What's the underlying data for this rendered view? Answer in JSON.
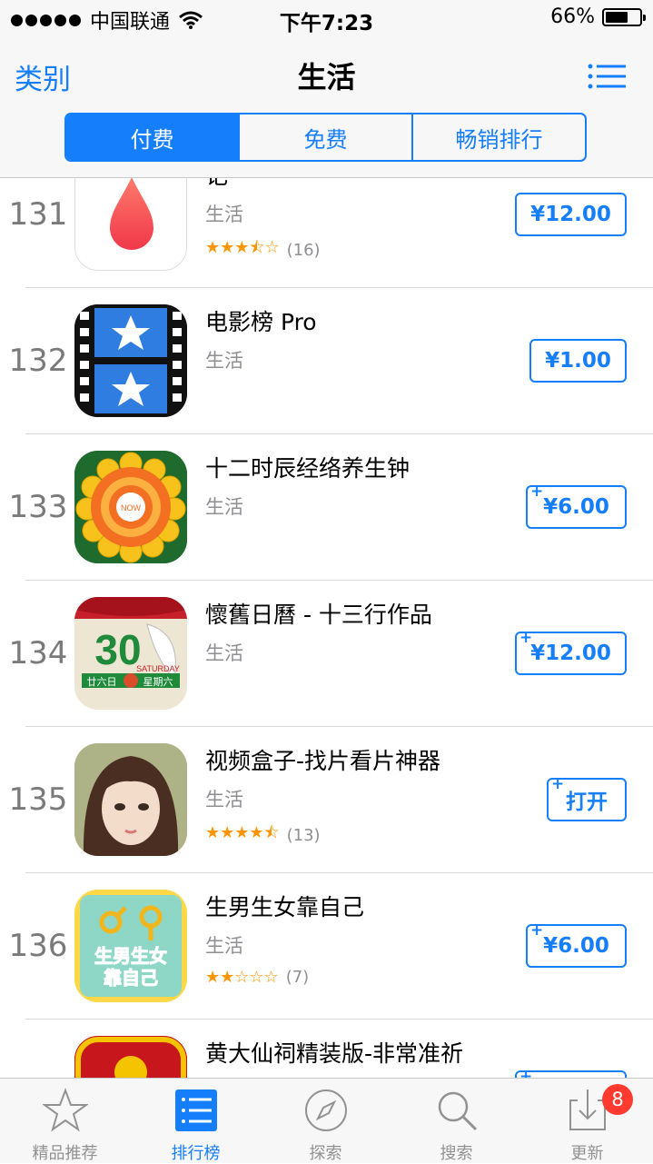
{
  "status_bar": {
    "carrier": "中国联通",
    "time": "下午7:23",
    "battery": "66%",
    "battery_level": 0.66
  },
  "nav": {
    "back_label": "类别",
    "title": "生活",
    "segments": [
      "付费",
      "免费",
      "畅销排行"
    ]
  },
  "apps": [
    {
      "rank": "131",
      "name": "记",
      "category": "生活",
      "stars": "★★★⯪☆",
      "rating_count": "(16)",
      "price": "¥12.00",
      "plus": false
    },
    {
      "rank": "132",
      "name": "电影榜 Pro",
      "category": "生活",
      "price": "¥1.00",
      "plus": false
    },
    {
      "rank": "133",
      "name": "十二时辰经络养生钟",
      "category": "生活",
      "price": "¥6.00",
      "plus": true
    },
    {
      "rank": "134",
      "name": "懷舊日曆 - 十三行作品",
      "category": "生活",
      "price": "¥12.00",
      "plus": true
    },
    {
      "rank": "135",
      "name": "视频盒子-找片看片神器",
      "category": "生活",
      "stars": "★★★★⯪",
      "rating_count": "(13)",
      "price": "打开",
      "plus": true
    },
    {
      "rank": "136",
      "name": "生男生女靠自己",
      "category": "生活",
      "stars": "★★☆☆☆",
      "rating_count": "(7)",
      "price": "¥6.00",
      "plus": true
    },
    {
      "rank": "",
      "name": "黄大仙祠精装版-非常准祈",
      "category": "",
      "price": "",
      "plus": true
    }
  ],
  "icon_texts": {
    "now": "NOW",
    "cal_day": "30",
    "cal_weekday": "SATURDAY",
    "cal_lunar": "廿六日",
    "cal_cn_weekday": "星期六",
    "app136_line1": "生男生女",
    "app136_line2": "靠自己"
  },
  "tab_bar": {
    "tabs": [
      {
        "label": "精品推荐",
        "icon": "star-icon"
      },
      {
        "label": "排行榜",
        "icon": "ranking-list-icon"
      },
      {
        "label": "探索",
        "icon": "compass-icon"
      },
      {
        "label": "搜索",
        "icon": "search-icon"
      },
      {
        "label": "更新",
        "icon": "download-icon"
      }
    ],
    "active": 1,
    "updates_badge": "8"
  },
  "colors": {
    "accent": "#157efb",
    "star": "#ff9500",
    "badge": "#ff3b30"
  }
}
